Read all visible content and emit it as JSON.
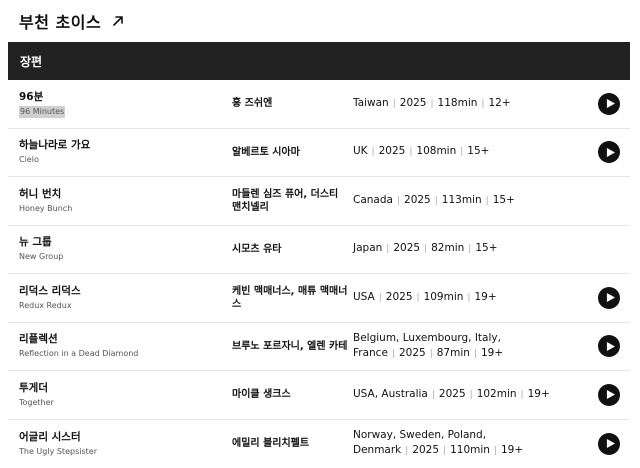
{
  "page": {
    "title": "부천 초이스",
    "arrow_icon": "arrow-up-right-icon"
  },
  "section": {
    "label": "장편"
  },
  "films": [
    {
      "title_ko": "96분",
      "title_en": "96 Minutes",
      "director": "홍 즈쉬엔",
      "info": [
        "Taiwan",
        "2025",
        "118min",
        "12+"
      ],
      "has_play": true,
      "highlight_en": true
    },
    {
      "title_ko": "하늘나라로 가요",
      "title_en": "Cielo",
      "director": "알베르토 시아마",
      "info": [
        "UK",
        "2025",
        "108min",
        "15+"
      ],
      "has_play": true
    },
    {
      "title_ko": "허니 번치",
      "title_en": "Honey Bunch",
      "director": "마들렌 심즈 퓨어, 더스티 맨치넬리",
      "info": [
        "Canada",
        "2025",
        "113min",
        "15+"
      ],
      "has_play": false
    },
    {
      "title_ko": "뉴 그룹",
      "title_en": "New Group",
      "director": "시모츠 유타",
      "info": [
        "Japan",
        "2025",
        "82min",
        "15+"
      ],
      "has_play": false
    },
    {
      "title_ko": "리덕스 리덕스",
      "title_en": "Redux Redux",
      "director": "케빈 맥매너스, 매튜 맥매너스",
      "info": [
        "USA",
        "2025",
        "109min",
        "19+"
      ],
      "has_play": true
    },
    {
      "title_ko": "리플렉션",
      "title_en": "Reflection in a Dead Diamond",
      "director": "브루노 포르자니, 엘렌 카테",
      "info": [
        "Belgium, Luxembourg, Italy, France",
        "2025",
        "87min",
        "19+"
      ],
      "has_play": true
    },
    {
      "title_ko": "투게더",
      "title_en": "Together",
      "director": "마이클 생크스",
      "info": [
        "USA, Australia",
        "2025",
        "102min",
        "19+"
      ],
      "has_play": true
    },
    {
      "title_ko": "어글리 시스터",
      "title_en": "The Ugly Stepsister",
      "director": "에밀리 블리치펠트",
      "info": [
        "Norway, Sweden, Poland, Denmark",
        "2025",
        "110min",
        "19+"
      ],
      "has_play": true
    }
  ],
  "icons": {
    "play": "play-icon"
  },
  "colors": {
    "header_bar": "#222222",
    "play_button": "#111111"
  }
}
